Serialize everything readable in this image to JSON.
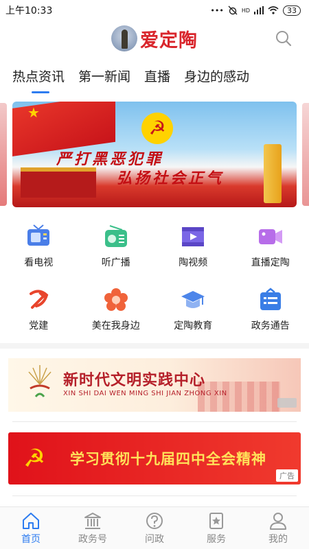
{
  "status_bar": {
    "time": "上午10:33",
    "signal_label": "HD",
    "battery": "33"
  },
  "header": {
    "app_title": "爱定陶"
  },
  "tabs": [
    {
      "label": "热点资讯",
      "active": true
    },
    {
      "label": "第一新闻",
      "active": false
    },
    {
      "label": "直播",
      "active": false
    },
    {
      "label": "身边的感动",
      "active": false
    }
  ],
  "banner": {
    "line1": "严打黑恶犯罪",
    "line2": "弘扬社会正气"
  },
  "grid": [
    {
      "label": "看电视",
      "icon": "tv-icon",
      "color": "#4a7ee8"
    },
    {
      "label": "听广播",
      "icon": "radio-icon",
      "color": "#3bbf8a"
    },
    {
      "label": "陶视频",
      "icon": "video-icon",
      "color": "#7a66e6"
    },
    {
      "label": "直播定陶",
      "icon": "camera-icon",
      "color": "#b76de9"
    },
    {
      "label": "党建",
      "icon": "party-emblem-icon",
      "color": "#e8452c"
    },
    {
      "label": "美在我身边",
      "icon": "flower-icon",
      "color": "#f0633a"
    },
    {
      "label": "定陶教育",
      "icon": "graduation-cap-icon",
      "color": "#4d86ea"
    },
    {
      "label": "政务通告",
      "icon": "notice-icon",
      "color": "#3a7ee6"
    }
  ],
  "civ_banner": {
    "title": "新时代文明实践中心",
    "subtitle": "XIN SHI DAI WEN MING SHI JIAN ZHONG XIN"
  },
  "party_banner": {
    "text": "学习贯彻十九届四中全会精神",
    "ad_label": "广告"
  },
  "bottom_nav": [
    {
      "label": "首页",
      "icon": "home-icon",
      "active": true
    },
    {
      "label": "政务号",
      "icon": "government-building-icon",
      "active": false
    },
    {
      "label": "问政",
      "icon": "question-icon",
      "active": false
    },
    {
      "label": "服务",
      "icon": "service-star-icon",
      "active": false
    },
    {
      "label": "我的",
      "icon": "profile-icon",
      "active": false
    }
  ],
  "colors": {
    "accent": "#2d7cf0",
    "brand_red": "#d9262c"
  }
}
